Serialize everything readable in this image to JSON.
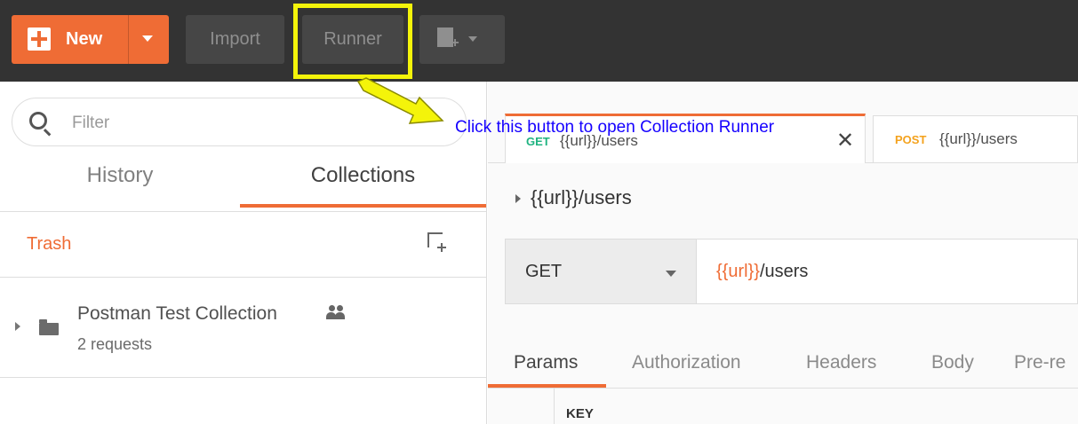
{
  "toolbar": {
    "new_label": "New",
    "import_label": "Import",
    "runner_label": "Runner",
    "accent_color": "#ef6c35",
    "new_window_icon": "new-window-icon"
  },
  "sidebar": {
    "filter_placeholder": "Filter",
    "tabs": [
      {
        "label": "History",
        "active": false
      },
      {
        "label": "Collections",
        "active": true
      }
    ],
    "trash_label": "Trash",
    "collections": [
      {
        "name": "Postman Test Collection",
        "count": "2 requests",
        "shared": true
      }
    ]
  },
  "main": {
    "request_tabs": [
      {
        "method": "GET",
        "url": "{{url}}/users",
        "active": true,
        "close": "✕"
      },
      {
        "method": "POST",
        "url": "{{url}}/users",
        "active": false
      }
    ],
    "request_title": "{{url}}/users",
    "urlbar": {
      "method": "GET",
      "url_var": "{{url}}",
      "url_path": "/users"
    },
    "subtabs": [
      "Params",
      "Authorization",
      "Headers",
      "Body",
      "Pre-re"
    ],
    "active_subtab": "Params",
    "table_header_key": "KEY"
  },
  "annotation": {
    "text": "Click this button to open Collection Runner",
    "highlight_color": "#f4f40a",
    "text_color": "#1500ff"
  }
}
